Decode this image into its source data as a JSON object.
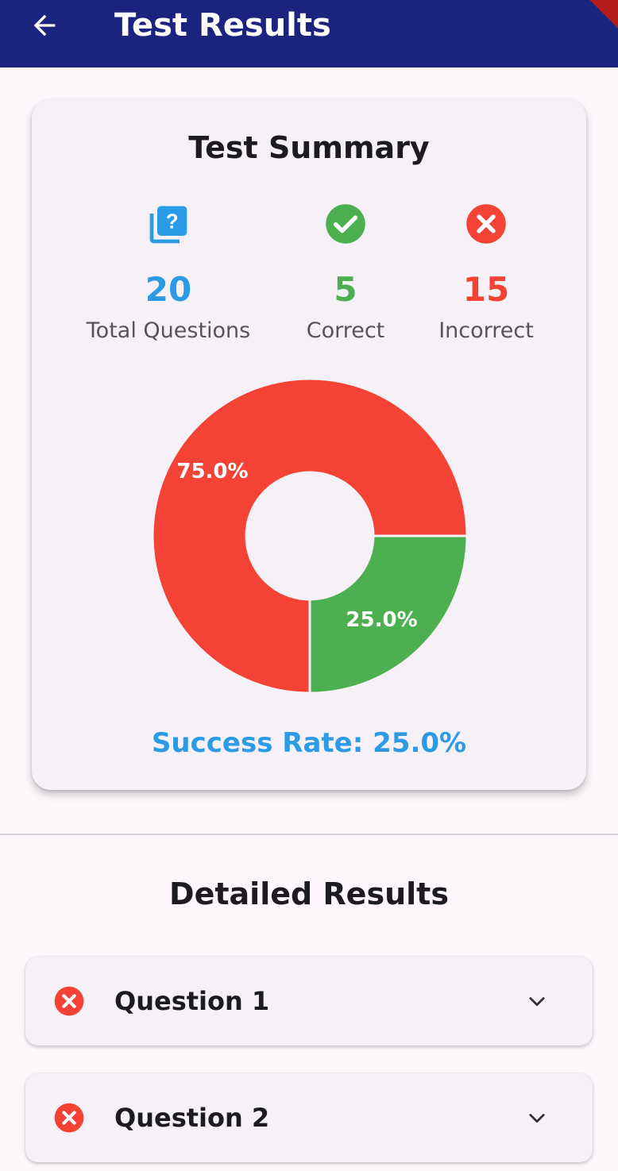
{
  "appbar": {
    "title": "Test Results",
    "back_icon": "arrow-back-icon",
    "color": "#1a237e"
  },
  "summary": {
    "title": "Test Summary",
    "stats": [
      {
        "icon": "quiz-icon",
        "value": "20",
        "label": "Total Questions",
        "color": "#2b9be6"
      },
      {
        "icon": "check-circle-icon",
        "value": "5",
        "label": "Correct",
        "color": "#4caf50"
      },
      {
        "icon": "cancel-circle-icon",
        "value": "15",
        "label": "Incorrect",
        "color": "#f44336"
      }
    ],
    "success_rate": "Success Rate: 25.0%"
  },
  "chart_data": {
    "type": "pie",
    "donut": true,
    "categories": [
      "Incorrect",
      "Correct"
    ],
    "values": [
      75.0,
      25.0
    ],
    "labels": [
      "75.0%",
      "25.0%"
    ],
    "colors": [
      "#f44336",
      "#4caf50"
    ]
  },
  "details": {
    "title": "Detailed Results",
    "items": [
      {
        "label": "Question 1",
        "status": "incorrect",
        "icon": "cancel-circle-icon"
      },
      {
        "label": "Question 2",
        "status": "incorrect",
        "icon": "cancel-circle-icon"
      }
    ]
  }
}
